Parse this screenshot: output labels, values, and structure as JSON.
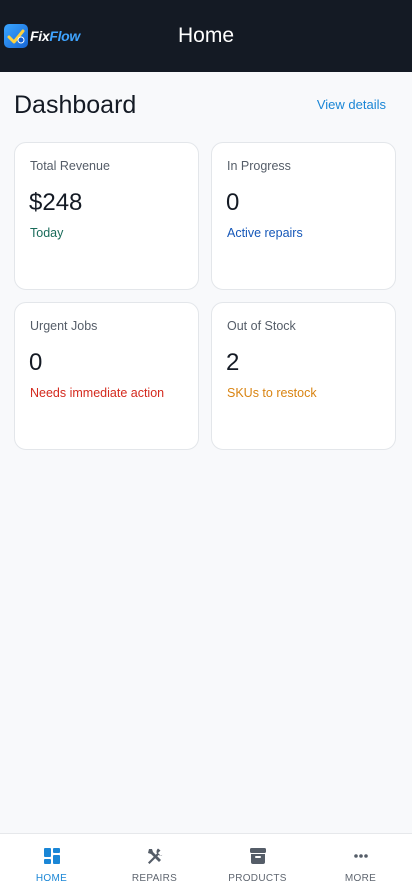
{
  "header": {
    "logo_text_part1": "Fix",
    "logo_text_part2": "Flow",
    "title": "Home"
  },
  "dashboard": {
    "title": "Dashboard",
    "view_details_label": "View details"
  },
  "cards": [
    {
      "label": "Total Revenue",
      "value": "$248",
      "sub": "Today",
      "sub_color": "#1a6b5a"
    },
    {
      "label": "In Progress",
      "value": "0",
      "sub": "Active repairs",
      "sub_color": "#1557b8"
    },
    {
      "label": "Urgent Jobs",
      "value": "0",
      "sub": "Needs immediate action",
      "sub_color": "#d42a1e"
    },
    {
      "label": "Out of Stock",
      "value": "2",
      "sub": "SKUs to restock",
      "sub_color": "#d98412"
    }
  ],
  "nav": {
    "items": [
      {
        "label": "HOME",
        "icon": "dashboard-icon",
        "active": true
      },
      {
        "label": "REPAIRS",
        "icon": "tools-icon",
        "active": false
      },
      {
        "label": "PRODUCTS",
        "icon": "archive-box-icon",
        "active": false
      },
      {
        "label": "MORE",
        "icon": "more-dots-icon",
        "active": false
      }
    ]
  },
  "colors": {
    "header_bg": "#141a24",
    "accent": "#1a86d6",
    "nav_inactive": "#5f6670"
  }
}
